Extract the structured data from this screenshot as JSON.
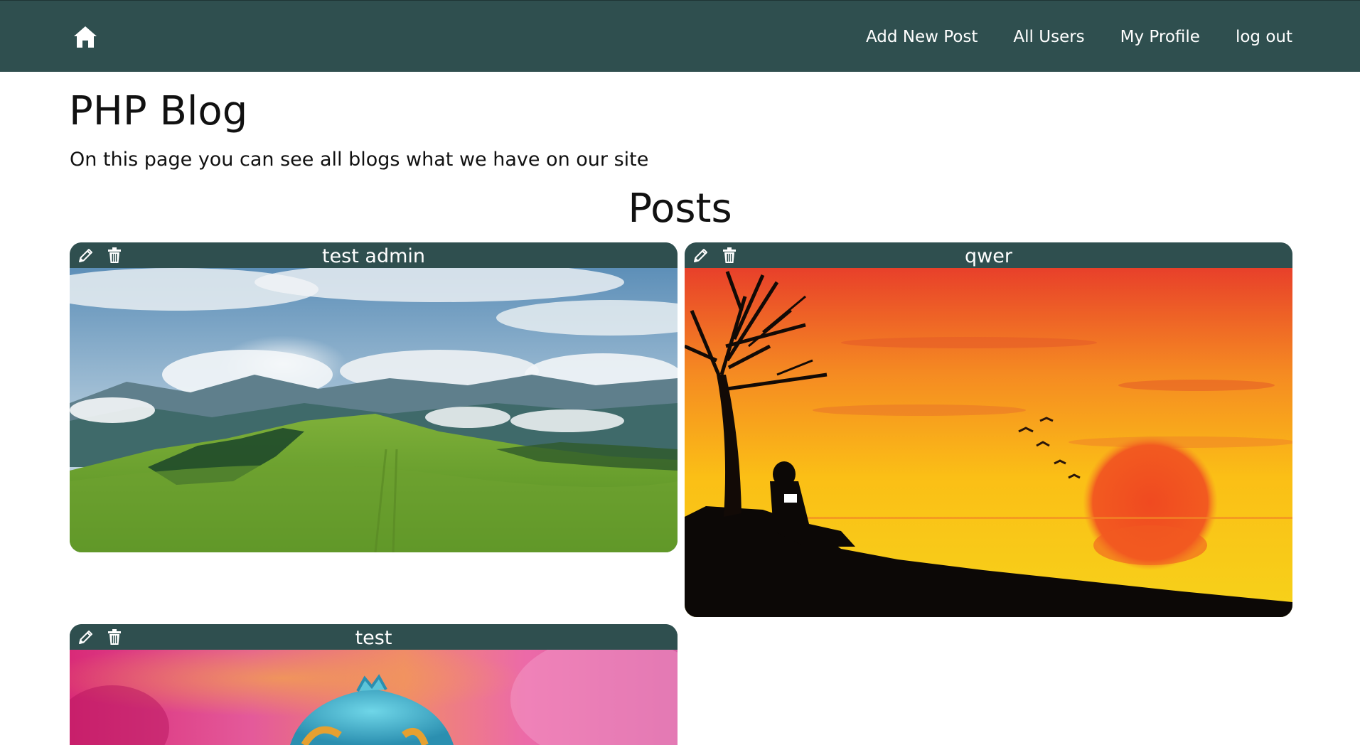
{
  "nav": {
    "home_icon": "home-icon",
    "links": [
      "Add New Post",
      "All Users",
      "My Profile",
      "log out"
    ],
    "bar_color": "#2f4f4f"
  },
  "header": {
    "title": "PHP Blog",
    "subtitle": "On this page you can see all blogs what we have on our site"
  },
  "posts": {
    "heading": "Posts",
    "items": [
      {
        "title": "test admin",
        "edit_icon": "pencil-icon",
        "delete_icon": "trash-icon",
        "image": "mountain meadow landscape with clouds"
      },
      {
        "title": "qwer",
        "edit_icon": "pencil-icon",
        "delete_icon": "trash-icon",
        "image": "sunset silhouette of person under tree"
      },
      {
        "title": "test",
        "edit_icon": "pencil-icon",
        "delete_icon": "trash-icon",
        "image": "colorful chameleon on pink background"
      }
    ]
  }
}
